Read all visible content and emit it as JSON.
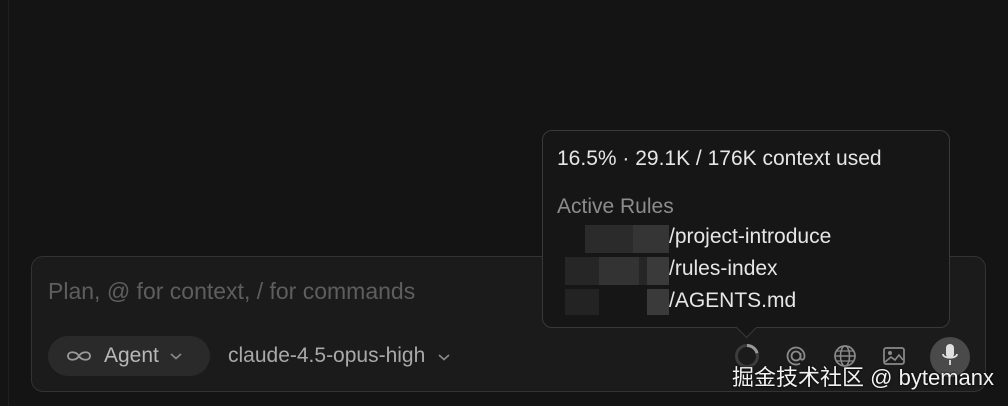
{
  "composer": {
    "placeholder": "Plan, @ for context, / for commands",
    "mode_label": "Agent",
    "model_label": "claude-4.5-opus-high"
  },
  "context_tooltip": {
    "usage_text": "16.5% · 29.1K / 176K context used",
    "usage_percent": 16.5,
    "rules_heading": "Active Rules",
    "rules": [
      {
        "name": "/project-introduce"
      },
      {
        "name": "/rules-index"
      },
      {
        "name": "/AGENTS.md"
      }
    ]
  },
  "icons": {
    "mode": "infinity-icon",
    "mode_chevron": "chevron-down-icon",
    "model_chevron": "chevron-down-icon",
    "context_ring": "context-ring-icon",
    "mention": "at-icon",
    "web": "globe-icon",
    "image": "image-icon",
    "voice": "microphone-icon"
  },
  "watermark": "掘金技术社区 @ bytemanx",
  "colors": {
    "background": "#141414",
    "composer_bg": "#1b1b1b",
    "border": "#333333",
    "tooltip_bg": "#161616",
    "text_primary": "#e6e6e6",
    "text_muted": "#8c8c8c"
  }
}
